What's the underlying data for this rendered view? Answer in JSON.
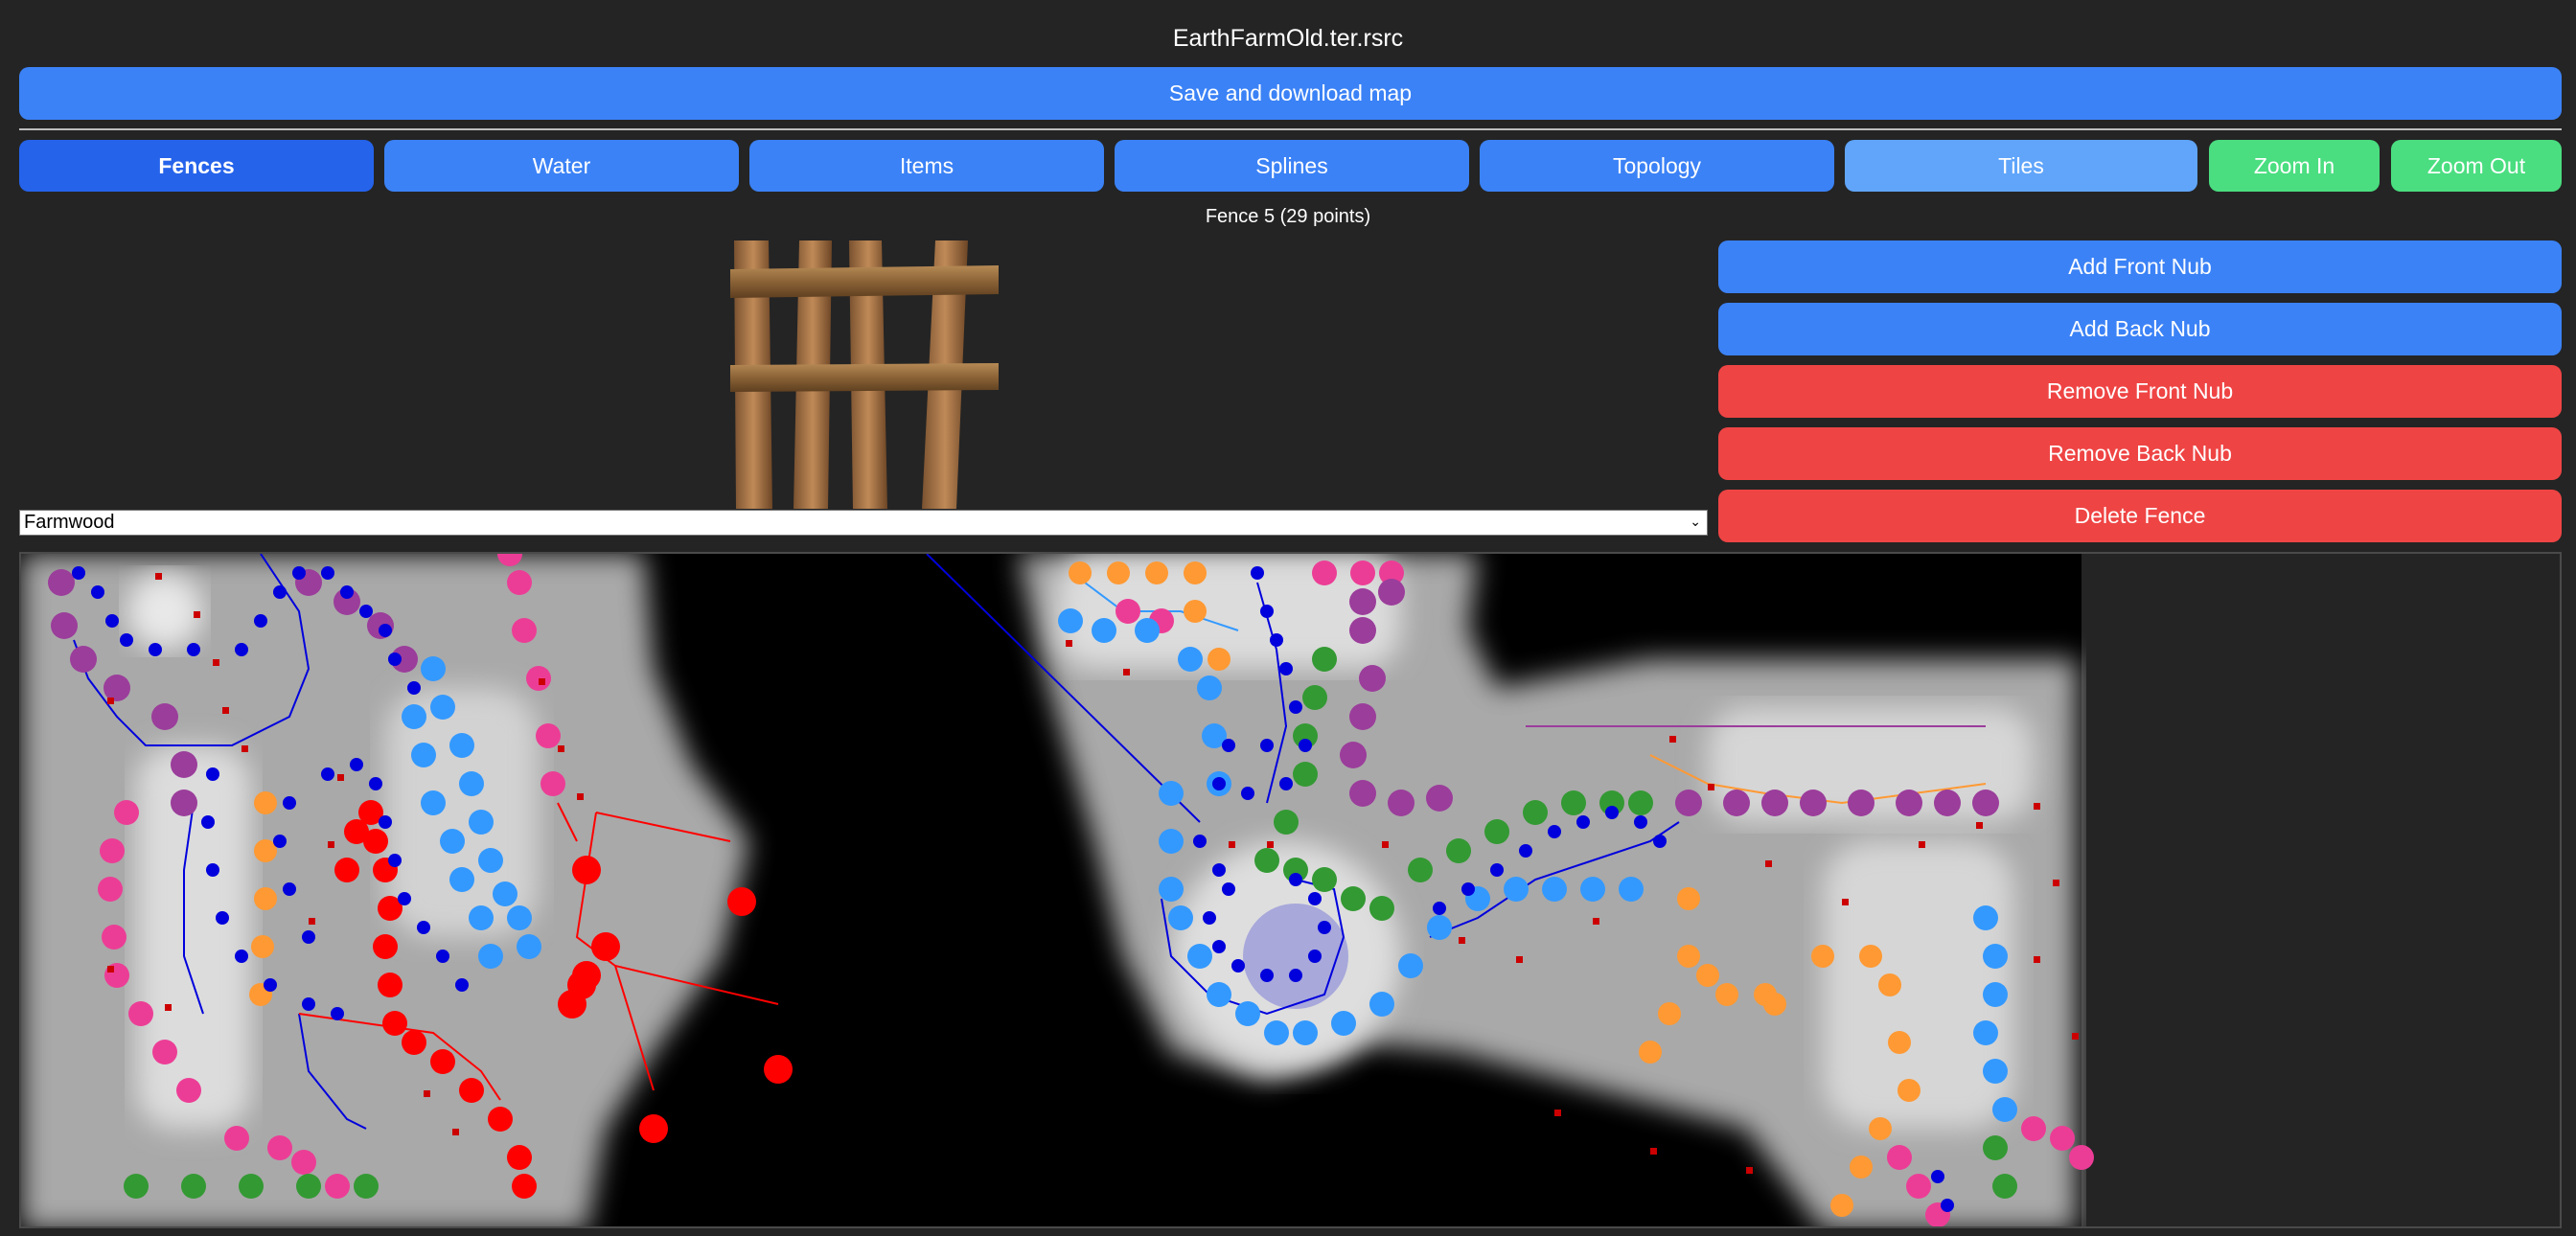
{
  "app": {
    "title": "EarthFarmOld.ter.rsrc"
  },
  "toolbar": {
    "save_label": "Save and download map"
  },
  "tabs": [
    {
      "label": "Fences",
      "state": "active"
    },
    {
      "label": "Water"
    },
    {
      "label": "Items"
    },
    {
      "label": "Splines"
    },
    {
      "label": "Topology"
    },
    {
      "label": "Tiles",
      "state": "dimmed"
    },
    {
      "label": "Zoom In"
    },
    {
      "label": "Zoom Out"
    }
  ],
  "fence": {
    "info": "Fence 5 (29 points)",
    "type_selected": "Farmwood",
    "actions": {
      "add_front": "Add Front Nub",
      "add_back": "Add Back Nub",
      "remove_front": "Remove Front Nub",
      "remove_back": "Remove Back Nub",
      "delete": "Delete Fence"
    }
  },
  "colors": {
    "accent": "#3b82f6",
    "active_tab": "#2563eb",
    "danger": "#ef4444",
    "zoom": "#4ade80",
    "fence_purple": "#9b3d9b",
    "fence_pink": "#ec3d96",
    "fence_orange": "#ff9933",
    "fence_lightblue": "#3399ff",
    "fence_green": "#339933",
    "fence_red": "#ff0000",
    "fence_blue": "#0000dd"
  }
}
